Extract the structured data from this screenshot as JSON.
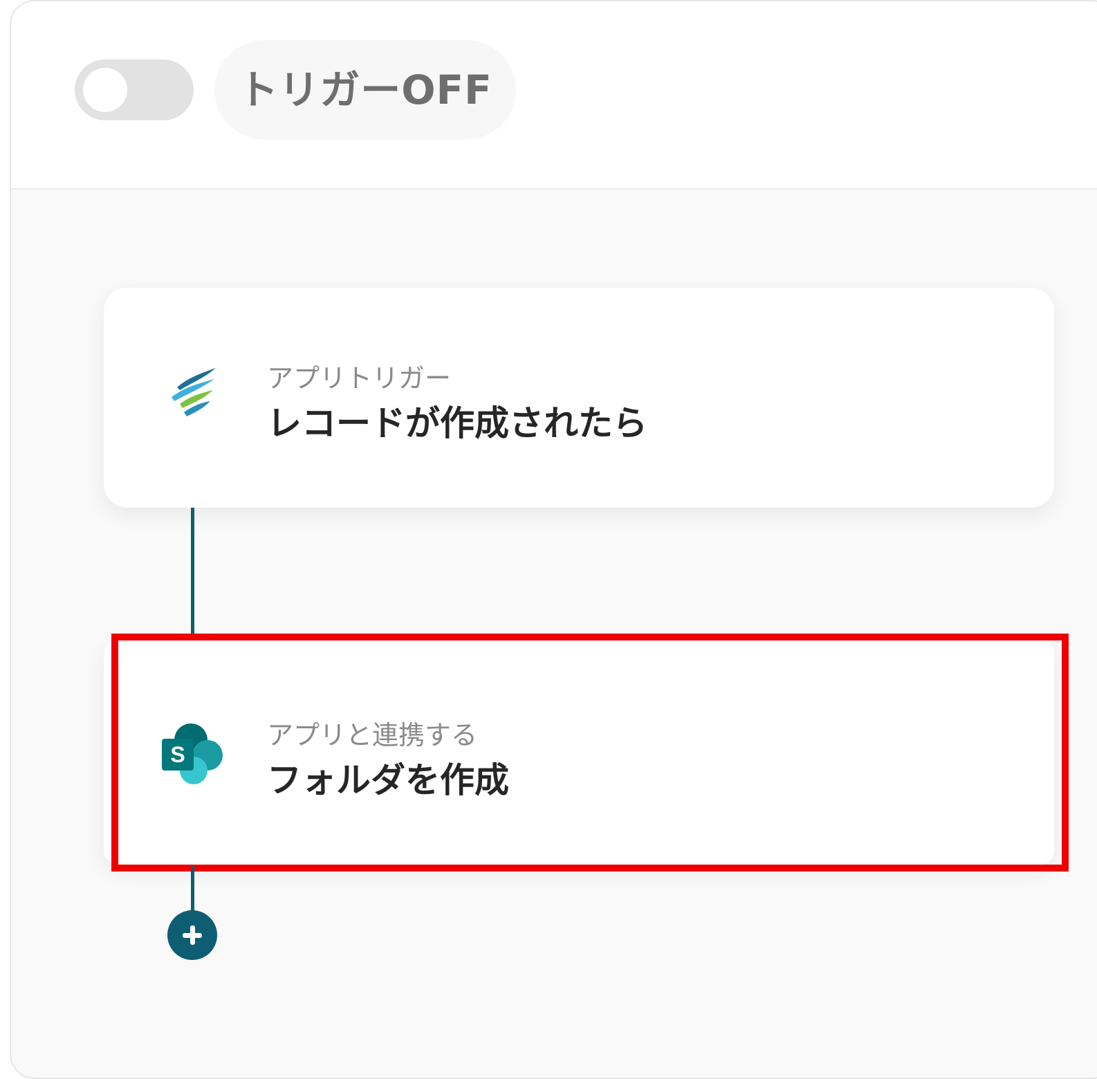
{
  "header": {
    "toggle_state": "off",
    "trigger_status_label": "トリガーOFF"
  },
  "flow": {
    "steps": [
      {
        "sub_label": "アプリトリガー",
        "title": "レコードが作成されたら",
        "icon": "kintone-swirl-icon"
      },
      {
        "sub_label": "アプリと連携する",
        "title": "フォルダを作成",
        "icon": "sharepoint-icon"
      }
    ],
    "add_step_icon": "plus-icon"
  },
  "colors": {
    "connector": "#0f5d73",
    "highlight_border": "#ee0000",
    "toggle_off": "#e2e2e2"
  }
}
